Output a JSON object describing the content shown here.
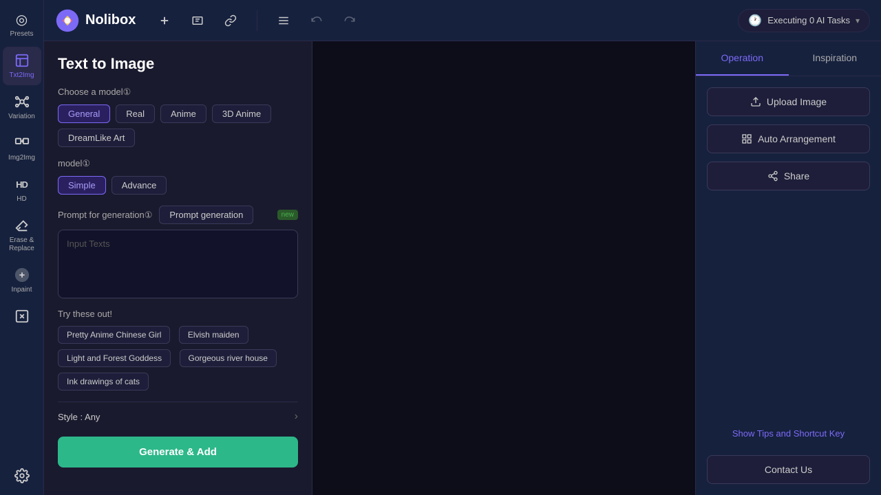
{
  "logo": {
    "text": "Nolibox"
  },
  "topbar": {
    "add_icon": "＋",
    "text_icon": "T",
    "link_icon": "⛓",
    "menu_icon": "☰",
    "undo_icon": "↩",
    "redo_icon": "↪",
    "executing_label": "Executing 0 AI Tasks"
  },
  "sidebar": {
    "items": [
      {
        "id": "presets",
        "label": "Presets",
        "icon": "◎"
      },
      {
        "id": "txt2img",
        "label": "Txt2Img",
        "icon": "🖼"
      },
      {
        "id": "variation",
        "label": "Variation",
        "icon": "⬡"
      },
      {
        "id": "img2img",
        "label": "Img2Img",
        "icon": "🔀"
      },
      {
        "id": "hd",
        "label": "HD",
        "icon": "HD"
      },
      {
        "id": "erase",
        "label": "Erase &\nReplace",
        "icon": "✦"
      },
      {
        "id": "inpaint",
        "label": "Inpaint",
        "icon": "⬡"
      },
      {
        "id": "remove",
        "label": "",
        "icon": "✕"
      },
      {
        "id": "settings",
        "label": "",
        "icon": "⚙"
      }
    ]
  },
  "left_panel": {
    "title": "Text to Image",
    "choose_model_label": "Choose a model①",
    "model_tags": [
      {
        "id": "general",
        "label": "General",
        "active": true
      },
      {
        "id": "real",
        "label": "Real",
        "active": false
      },
      {
        "id": "anime",
        "label": "Anime",
        "active": false
      },
      {
        "id": "3danime",
        "label": "3D Anime",
        "active": false
      },
      {
        "id": "dreamlike",
        "label": "DreamLike Art",
        "active": false
      }
    ],
    "mode_label": "model①",
    "mode_tags": [
      {
        "id": "simple",
        "label": "Simple",
        "active": true
      },
      {
        "id": "advance",
        "label": "Advance",
        "active": false
      }
    ],
    "prompt_label": "Prompt for generation①",
    "prompt_gen_btn": "Prompt generation",
    "new_label": "new",
    "input_placeholder": "Input Texts",
    "try_these_label": "Try these out!",
    "try_tags": [
      {
        "id": "anime-girl",
        "label": "Pretty Anime Chinese Girl"
      },
      {
        "id": "elvish",
        "label": "Elvish maiden"
      },
      {
        "id": "forest",
        "label": "Light and Forest Goddess"
      },
      {
        "id": "river",
        "label": "Gorgeous river house"
      },
      {
        "id": "ink",
        "label": "Ink drawings of cats"
      }
    ],
    "style_label": "Style : Any",
    "generate_btn": "Generate & Add"
  },
  "right_panel": {
    "tabs": [
      {
        "id": "operation",
        "label": "Operation",
        "active": true
      },
      {
        "id": "inspiration",
        "label": "Inspiration",
        "active": false
      }
    ],
    "upload_btn": "Upload Image",
    "arrange_btn": "Auto Arrangement",
    "share_icon": "⤢",
    "share_btn": "Share",
    "show_tips": "Show Tips and Shortcut Key",
    "contact_btn": "Contact Us"
  }
}
